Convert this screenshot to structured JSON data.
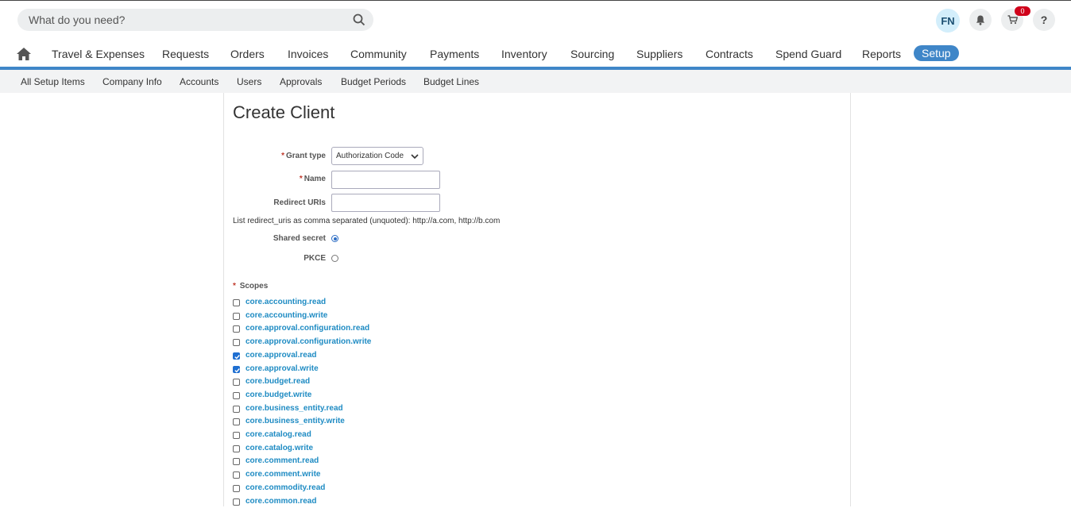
{
  "header": {
    "search_placeholder": "What do you need?",
    "user_initials": "FN",
    "cart_count": "0",
    "help_label": "?"
  },
  "nav": {
    "items": [
      "Travel & Expenses",
      "Requests",
      "Orders",
      "Invoices",
      "Community",
      "Payments",
      "Inventory",
      "Sourcing",
      "Suppliers",
      "Contracts",
      "Spend Guard",
      "Reports",
      "Setup"
    ],
    "active": "Setup"
  },
  "subnav": {
    "items": [
      "All Setup Items",
      "Company Info",
      "Accounts",
      "Users",
      "Approvals",
      "Budget Periods",
      "Budget Lines"
    ]
  },
  "form": {
    "title": "Create Client",
    "required_mark": "*",
    "grant_type_label": "Grant type",
    "grant_type_value": "Authorization Code",
    "name_label": "Name",
    "name_value": "",
    "redirect_label": "Redirect URIs",
    "redirect_value": "",
    "redirect_hint": "List redirect_uris as comma separated (unquoted): http://a.com, http://b.com",
    "shared_secret_label": "Shared secret",
    "shared_secret_selected": true,
    "pkce_label": "PKCE",
    "pkce_selected": false,
    "scopes_label": "Scopes",
    "scopes": [
      {
        "name": "core.accounting.read",
        "checked": false
      },
      {
        "name": "core.accounting.write",
        "checked": false
      },
      {
        "name": "core.approval.configuration.read",
        "checked": false
      },
      {
        "name": "core.approval.configuration.write",
        "checked": false
      },
      {
        "name": "core.approval.read",
        "checked": true
      },
      {
        "name": "core.approval.write",
        "checked": true
      },
      {
        "name": "core.budget.read",
        "checked": false
      },
      {
        "name": "core.budget.write",
        "checked": false
      },
      {
        "name": "core.business_entity.read",
        "checked": false
      },
      {
        "name": "core.business_entity.write",
        "checked": false
      },
      {
        "name": "core.catalog.read",
        "checked": false
      },
      {
        "name": "core.catalog.write",
        "checked": false
      },
      {
        "name": "core.comment.read",
        "checked": false
      },
      {
        "name": "core.comment.write",
        "checked": false
      },
      {
        "name": "core.commodity.read",
        "checked": false
      },
      {
        "name": "core.common.read",
        "checked": false
      }
    ]
  },
  "colors": {
    "accent": "#3f86c8",
    "link": "#1e8bc3",
    "badge": "#d0021b",
    "required": "#c0392b"
  }
}
